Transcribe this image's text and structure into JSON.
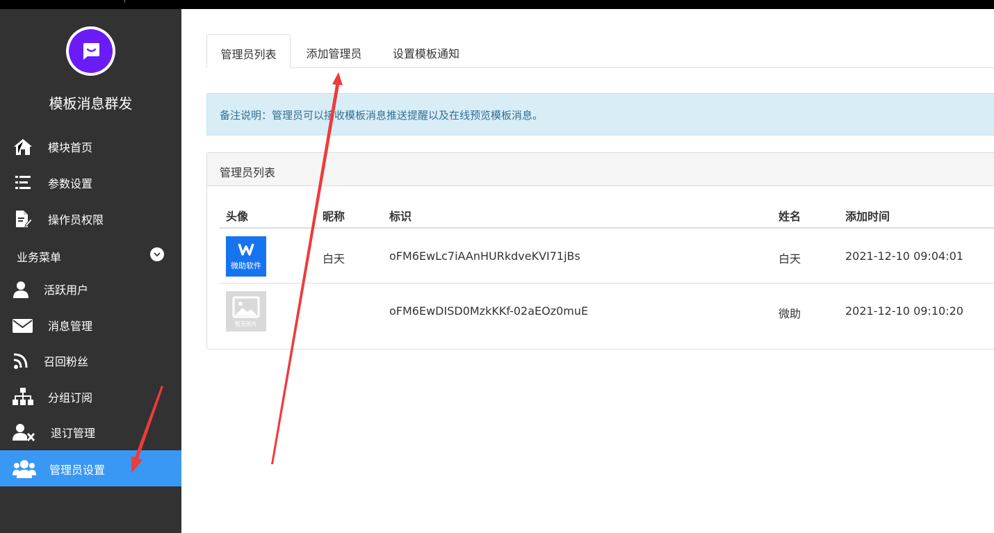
{
  "app": {
    "title": "模板消息群发",
    "accent_color": "#3a98f5",
    "logo_color": "#6a1cf6"
  },
  "sidebar": {
    "items": [
      {
        "label": "模块首页",
        "icon": "home-icon"
      },
      {
        "label": "参数设置",
        "icon": "list-settings-icon"
      },
      {
        "label": "操作员权限",
        "icon": "document-edit-icon"
      }
    ],
    "section": {
      "label": "业务菜单",
      "icon": "chevron-down-icon"
    },
    "business_items": [
      {
        "label": "活跃用户",
        "icon": "user-icon"
      },
      {
        "label": "消息管理",
        "icon": "envelope-icon"
      },
      {
        "label": "召回粉丝",
        "icon": "rss-icon"
      },
      {
        "label": "分组订阅",
        "icon": "sitemap-icon"
      },
      {
        "label": "退订管理",
        "icon": "user-remove-icon"
      },
      {
        "label": "管理员设置",
        "icon": "users-icon",
        "active": true
      }
    ]
  },
  "tabs": [
    {
      "label": "管理员列表",
      "active": true
    },
    {
      "label": "添加管理员"
    },
    {
      "label": "设置模板通知"
    }
  ],
  "notice": {
    "text": "备注说明：管理员可以接收模板消息推送提醒以及在线预览模板消息。"
  },
  "panel": {
    "title": "管理员列表",
    "columns": [
      "头像",
      "昵称",
      "标识",
      "姓名",
      "添加时间"
    ],
    "rows": [
      {
        "avatar_text": "微助软件",
        "avatar_color": "#1774f0",
        "nickname": "白天",
        "openid": "oFM6EwLc7iAAnHURkdveKVI71jBs",
        "name": "白天",
        "added": "2021-12-10 09:04:01"
      },
      {
        "avatar_text": "暂无图片",
        "avatar_color": "#d9d9d9",
        "nickname": "",
        "openid": "oFM6EwDISD0MzkKKf-02aEOz0muE",
        "name": "微助",
        "added": "2021-12-10 09:10:20"
      }
    ]
  },
  "annotations": {
    "arrow_color": "#ee3b3b"
  }
}
